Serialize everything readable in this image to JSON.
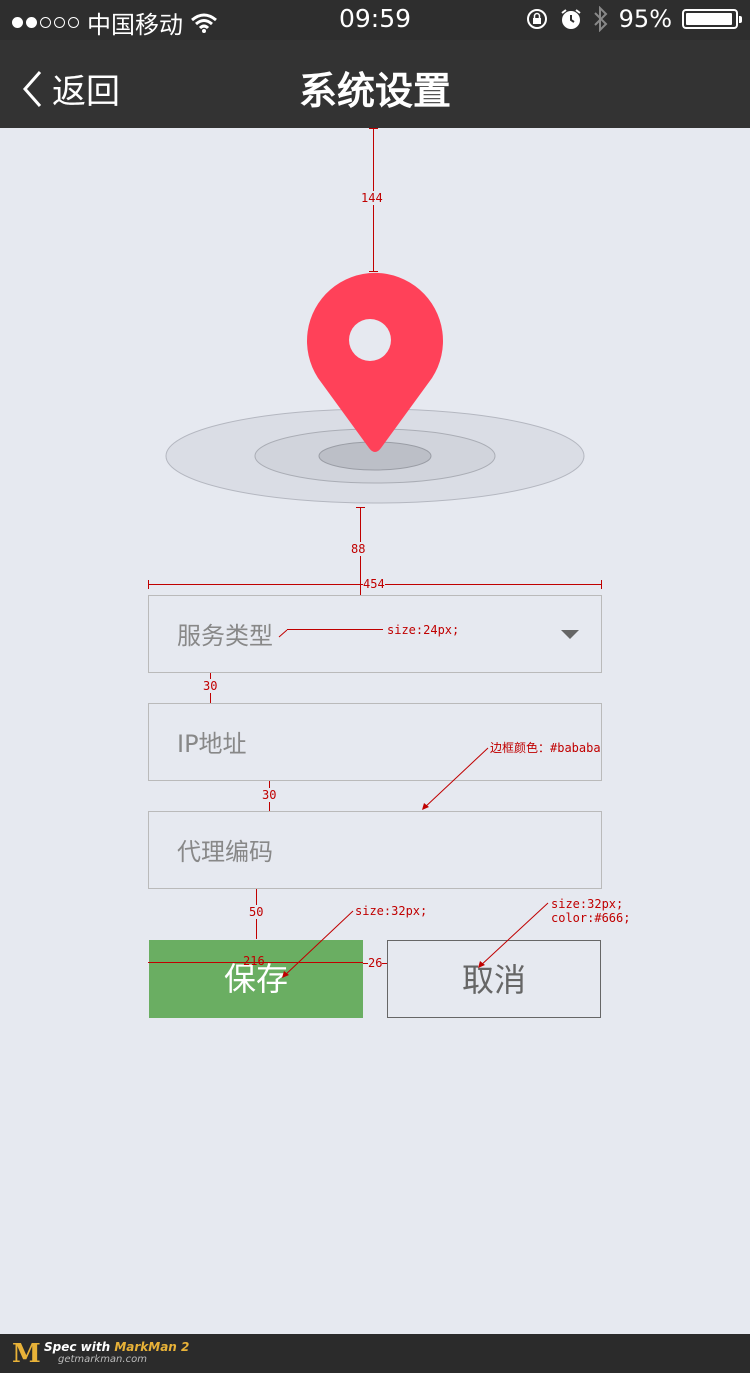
{
  "status": {
    "carrier": "中国移动",
    "time": "09:59",
    "battery": "95%",
    "battery_level": 0.95
  },
  "nav": {
    "back_label": "返回",
    "title": "系统设置"
  },
  "annotations": {
    "a144": "144",
    "a88": "88",
    "a454": "454",
    "size24": "size:24px;",
    "a30a": "30",
    "border": "边框颜色：#bababa;",
    "a30b": "30",
    "a50": "50",
    "size32a": "size:32px;",
    "size32b": "size:32px;",
    "color666": "color:#666;",
    "a216": "216",
    "a26": "26"
  },
  "form": {
    "service_type": "服务类型",
    "ip": "IP地址",
    "agent_code": "代理编码"
  },
  "buttons": {
    "save": "保存",
    "cancel": "取消"
  },
  "footer": {
    "spec": "Spec with",
    "brand": "MarkMan 2",
    "site": "getmarkman.com"
  },
  "colors": {
    "pin": "#ff4159",
    "save": "#6aae62",
    "border": "#bababa"
  }
}
